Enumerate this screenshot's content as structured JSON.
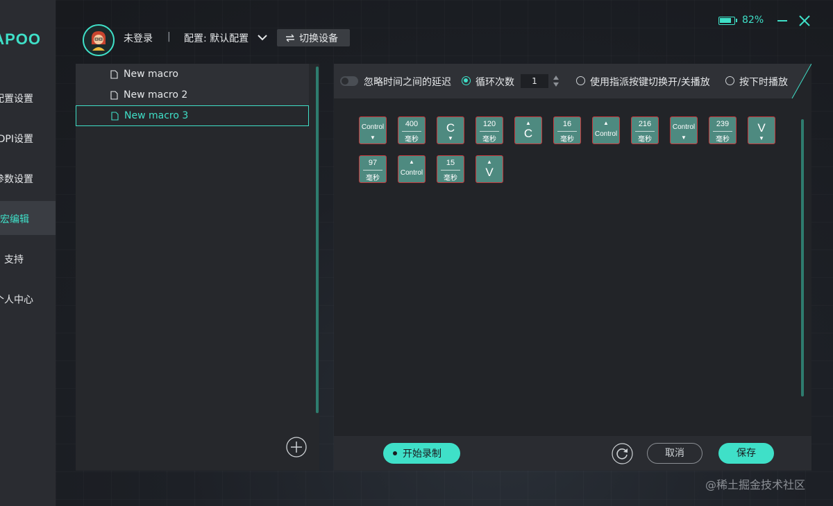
{
  "app": {
    "brand": "RAPOO",
    "accent_color": "#3fe0c8"
  },
  "sidebar": {
    "items": [
      {
        "label": "配置设置",
        "icon": ""
      },
      {
        "label": "DPI设置"
      },
      {
        "label": "参数设置"
      },
      {
        "label": "宏编辑",
        "active": true
      },
      {
        "label": "支持"
      },
      {
        "label": "个人中心"
      }
    ]
  },
  "header": {
    "user_status": "未登录",
    "separator": "|",
    "config_label": "配置: 默认配置",
    "switch_device_label": "切换设备",
    "battery_percent": 82,
    "battery_label": "82%"
  },
  "macro_list": {
    "items": [
      {
        "name": "New macro"
      },
      {
        "name": "New macro 2"
      },
      {
        "name": "New macro 3",
        "selected": true
      }
    ]
  },
  "toolbar": {
    "ignore_delay_label": "忽略时间之间的延迟",
    "loop_count_label": "循环次数",
    "loop_count_value": "1",
    "toggle_by_key_label": "使用指派按键切换开/关播放",
    "press_play_label": "按下时播放"
  },
  "macro_steps": [
    {
      "type": "key",
      "label": "Control",
      "dir": "down"
    },
    {
      "type": "delay",
      "value": "400",
      "unit": "毫秒"
    },
    {
      "type": "key",
      "label": "C",
      "dir": "down"
    },
    {
      "type": "delay",
      "value": "120",
      "unit": "毫秒"
    },
    {
      "type": "key",
      "label": "C",
      "dir": "up"
    },
    {
      "type": "delay",
      "value": "16",
      "unit": "毫秒"
    },
    {
      "type": "key",
      "label": "Control",
      "dir": "up"
    },
    {
      "type": "delay",
      "value": "216",
      "unit": "毫秒"
    },
    {
      "type": "key",
      "label": "Control",
      "dir": "down"
    },
    {
      "type": "delay",
      "value": "239",
      "unit": "毫秒"
    },
    {
      "type": "key",
      "label": "V",
      "dir": "down"
    },
    {
      "type": "delay",
      "value": "97",
      "unit": "毫秒"
    },
    {
      "type": "key",
      "label": "Control",
      "dir": "up"
    },
    {
      "type": "delay",
      "value": "15",
      "unit": "毫秒"
    },
    {
      "type": "key",
      "label": "V",
      "dir": "up"
    }
  ],
  "bottom": {
    "record_label": "开始录制",
    "cancel_label": "取消",
    "save_label": "保存"
  },
  "watermark": "@稀土掘金技术社区"
}
